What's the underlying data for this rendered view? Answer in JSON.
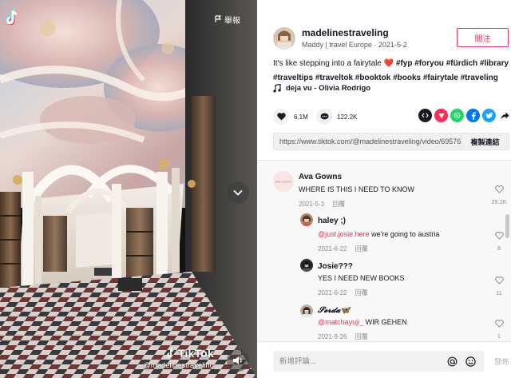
{
  "video": {
    "report_label": "舉報",
    "watermark_brand": "TikTok",
    "watermark_handle": "@madelinestraveling"
  },
  "author": {
    "username": "madelinestraveling",
    "meta": "Maddy | travel Europe · 2021-5-2",
    "follow_label": "關注"
  },
  "description": {
    "text": "It's like stepping into a fairytale",
    "heart": "❤️",
    "hashtags": [
      "#fyp",
      "#foryou",
      "#fürdich",
      "#library",
      "#traveltips",
      "#traveltok",
      "#booktok",
      "#books",
      "#fairytale",
      "#traveling"
    ]
  },
  "music": {
    "title": "deja vu - Olivia Rodrigo"
  },
  "stats": {
    "likes": "6.1M",
    "comments": "122.2K"
  },
  "share": {
    "icons": [
      "embed-icon",
      "tiktok-send-icon",
      "whatsapp-icon",
      "facebook-icon",
      "twitter-icon",
      "share-arrow-icon"
    ],
    "colors": {
      "embed": "#161823",
      "send": "#fe2c55",
      "whatsapp": "#25d366",
      "facebook": "#0075fa",
      "twitter": "#1da1f2"
    }
  },
  "link": {
    "url": "https://www.tiktok.com/@madelinestraveling/video/695766...",
    "copy_label": "複製連結"
  },
  "comments": [
    {
      "name": "Ava Gowns",
      "avatar_text": "AVA GOWNS",
      "text": "WHERE IS THIS I NEED TO KNOW",
      "date": "2021-5-3",
      "reply_label": "回覆",
      "likes": "29.2K"
    },
    {
      "name": "haley ;)",
      "mention": "@just.josie.here",
      "text": " we're going to austria",
      "date": "2021-6-22",
      "reply_label": "回覆",
      "likes": "8"
    },
    {
      "name": "Josie???",
      "text": "YES I NEED NEW BOOKS",
      "date": "2021-6-22",
      "reply_label": "回覆",
      "likes": "11"
    },
    {
      "name": "𝓢𝓮𝓻𝓭𝓪🦋",
      "mention": "@matchayuji_",
      "text": " WIR GEHEN",
      "date": "2021-9-26",
      "reply_label": "回覆",
      "likes": "1"
    }
  ],
  "comment_input": {
    "placeholder": "新增評論...",
    "post_label": "發佈"
  },
  "colors": {
    "accent": "#fe2c55",
    "text": "#161823"
  }
}
